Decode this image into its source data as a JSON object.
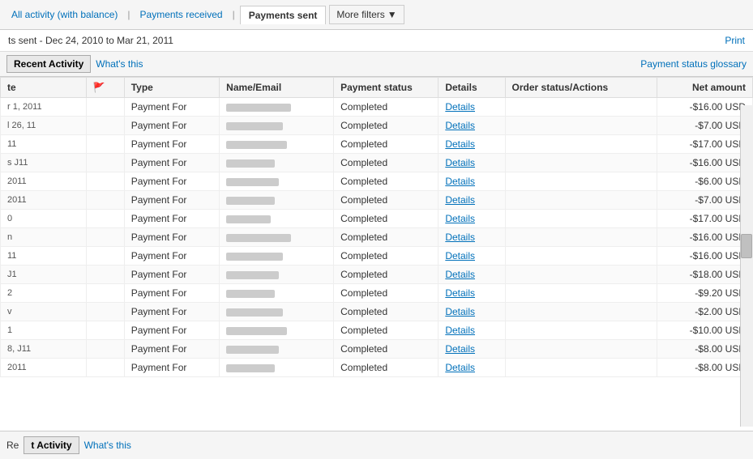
{
  "nav": {
    "all_activity_label": "All activity (with balance)",
    "payments_received_label": "Payments received",
    "payments_sent_label": "Payments sent",
    "more_filters_label": "More filters",
    "chevron": "▼"
  },
  "date_range": {
    "text": "ts sent - Dec 24, 2010 to Mar 21, 2011",
    "print_label": "Print"
  },
  "activity_bar": {
    "recent_activity_label": "Recent Activity",
    "whats_this_label": "What's this",
    "glossary_label": "Payment status glossary"
  },
  "table": {
    "headers": [
      {
        "key": "date",
        "label": "te",
        "class": "col-date"
      },
      {
        "key": "flag",
        "label": "🚩",
        "class": "col-flag"
      },
      {
        "key": "type",
        "label": "Type",
        "class": "col-type"
      },
      {
        "key": "name",
        "label": "Name/Email",
        "class": "col-name"
      },
      {
        "key": "status",
        "label": "Payment status",
        "class": "col-status"
      },
      {
        "key": "details",
        "label": "Details",
        "class": "col-details"
      },
      {
        "key": "order",
        "label": "Order status/Actions",
        "class": "col-order"
      },
      {
        "key": "amount",
        "label": "Net amount",
        "class": "col-amount right"
      }
    ],
    "rows": [
      {
        "date": "r 1, 2011",
        "type": "Payment For",
        "name_width": 80,
        "status": "Completed",
        "amount": "-$16.00 USD"
      },
      {
        "date": "l 26, 11",
        "type": "Payment For",
        "name_width": 70,
        "status": "Completed",
        "amount": "-$7.00 USD"
      },
      {
        "date": "11",
        "type": "Payment For",
        "name_width": 75,
        "status": "Completed",
        "amount": "-$17.00 USD"
      },
      {
        "date": "s J11",
        "type": "Payment For",
        "name_width": 60,
        "status": "Completed",
        "amount": "-$16.00 USD"
      },
      {
        "date": "2011",
        "type": "Payment For",
        "name_width": 65,
        "status": "Completed",
        "amount": "-$6.00 USD"
      },
      {
        "date": "2011",
        "type": "Payment For",
        "name_width": 60,
        "status": "Completed",
        "amount": "-$7.00 USD"
      },
      {
        "date": "0",
        "type": "Payment For",
        "name_width": 55,
        "status": "Completed",
        "amount": "-$17.00 USD"
      },
      {
        "date": "n",
        "type": "Payment For",
        "name_width": 80,
        "status": "Completed",
        "amount": "-$16.00 USD"
      },
      {
        "date": "11",
        "type": "Payment For",
        "name_width": 70,
        "status": "Completed",
        "amount": "-$16.00 USD"
      },
      {
        "date": "J1",
        "type": "Payment For",
        "name_width": 65,
        "status": "Completed",
        "amount": "-$18.00 USD"
      },
      {
        "date": "2",
        "type": "Payment For",
        "name_width": 60,
        "status": "Completed",
        "amount": "-$9.20 USD"
      },
      {
        "date": "v",
        "type": "Payment For",
        "name_width": 70,
        "status": "Completed",
        "amount": "-$2.00 USD"
      },
      {
        "date": "1",
        "type": "Payment For",
        "name_width": 75,
        "status": "Completed",
        "amount": "-$10.00 USD"
      },
      {
        "date": "8, J11",
        "type": "Payment For",
        "name_width": 65,
        "status": "Completed",
        "amount": "-$8.00 USD"
      },
      {
        "date": "2011",
        "type": "Payment For",
        "name_width": 60,
        "status": "Completed",
        "amount": "-$8.00 USD"
      }
    ],
    "details_label": "Details"
  },
  "bottom": {
    "recent_label": "t Activity",
    "whats_this_label": "What's this"
  }
}
